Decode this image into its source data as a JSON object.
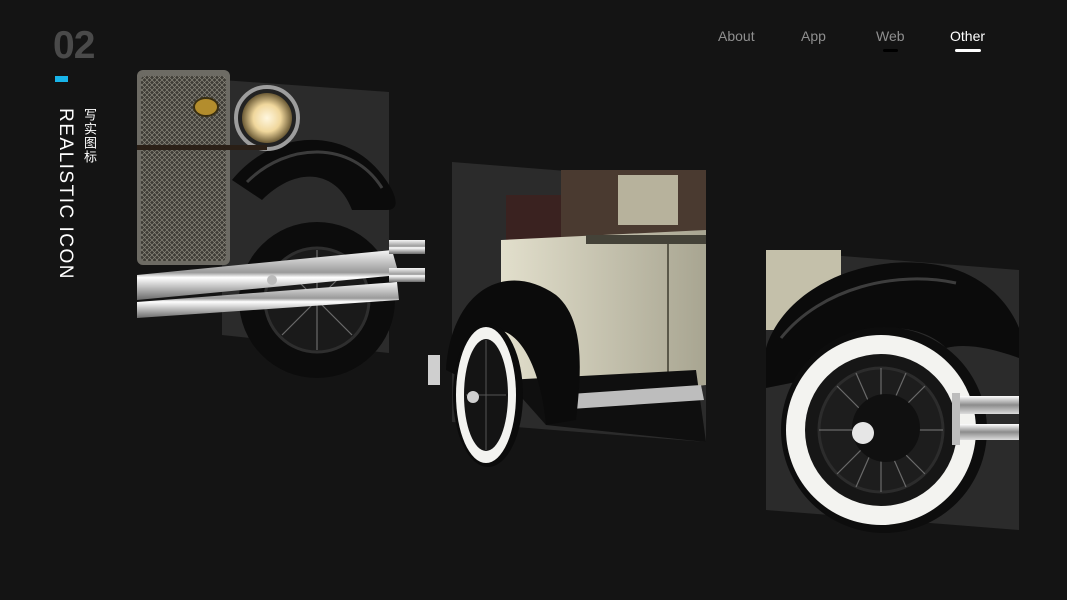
{
  "section": {
    "number": "02",
    "title_en": "REALISTIC ICON",
    "title_cn": "写实图标",
    "accent_color": "#18b4e9"
  },
  "nav": {
    "items": [
      {
        "label": "About",
        "active": false
      },
      {
        "label": "App",
        "active": false
      },
      {
        "label": "Web",
        "active": false
      },
      {
        "label": "Other",
        "active": true
      }
    ]
  },
  "colors": {
    "background": "#141414",
    "body_cream": "#c9c6b2",
    "fender_black": "#0b0b0b",
    "chrome": "#d8d8d8",
    "whitewall": "#f3f3f0"
  },
  "illustrations": [
    {
      "name": "front-grille-headlight",
      "icon": "vintage-car-front-icon"
    },
    {
      "name": "door-running-board",
      "icon": "vintage-car-door-icon"
    },
    {
      "name": "rear-wheel",
      "icon": "vintage-car-wheel-icon"
    }
  ]
}
